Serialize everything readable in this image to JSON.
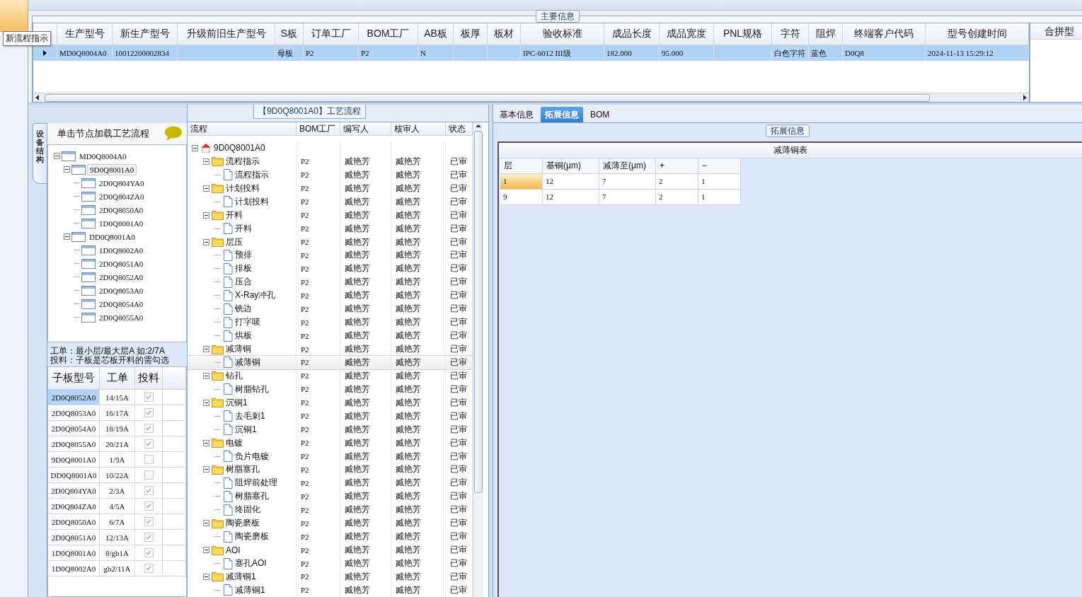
{
  "tooltip": "新流程指示",
  "main_info": {
    "title": "主要信息",
    "columns": [
      "生产型号",
      "新生产型号",
      "升级前旧生产型号",
      "S板",
      "订单工厂",
      "BOM工厂",
      "AB板",
      "板厚",
      "板材",
      "验收标准",
      "成品长度",
      "成品宽度",
      "PNL规格",
      "字符",
      "阻焊",
      "终端客户代码",
      "型号创建时间"
    ],
    "rows": [
      {
        "selected": true,
        "cells": [
          "MD0Q8004A0",
          "10012200002834",
          null,
          "母板",
          "P2",
          "P2",
          "N",
          null,
          null,
          "IPC-6012 III级",
          "182.000",
          "95.000",
          null,
          "白色字符",
          "蓝色",
          "D0Q8",
          "2024-11-13 15:29:12"
        ]
      }
    ]
  },
  "merge_panel": {
    "title": "合拼型"
  },
  "structure": {
    "tab": "设备结构",
    "hint": "单击节点加载工艺流程",
    "tree": [
      {
        "name": "MD0Q8004A0",
        "selected": false,
        "expanded": true,
        "children": [
          {
            "name": "9D0Q8001A0",
            "selected": true,
            "expanded": true,
            "children": [
              {
                "name": "2D0Q804YA0",
                "selected": false
              },
              {
                "name": "2D0Q804ZA0",
                "selected": false
              },
              {
                "name": "2D0Q8050A0",
                "selected": false
              },
              {
                "name": "1D0Q8001A0",
                "selected": false
              }
            ]
          },
          {
            "name": "DD0Q8001A0",
            "selected": false,
            "expanded": true,
            "children": [
              {
                "name": "1D0Q8002A0",
                "selected": false
              },
              {
                "name": "2D0Q8051A0",
                "selected": false
              },
              {
                "name": "2D0Q8052A0",
                "selected": false
              },
              {
                "name": "2D0Q8053A0",
                "selected": false
              },
              {
                "name": "2D0Q8054A0",
                "selected": false
              },
              {
                "name": "2D0Q8055A0",
                "selected": false
              }
            ]
          }
        ]
      }
    ],
    "notes": [
      "工单：最小层/最大层A 如:2/7A",
      "投料：子板是芯板开料的需勾选"
    ],
    "table": {
      "columns": [
        "子板型号",
        "工单",
        "投料"
      ],
      "rows": [
        {
          "board": "2D0Q8052A0",
          "order": "14/15A",
          "checked": true,
          "selected": true
        },
        {
          "board": "2D0Q8053A0",
          "order": "16/17A",
          "checked": true,
          "selected": false
        },
        {
          "board": "2D0Q8054A0",
          "order": "18/19A",
          "checked": true,
          "selected": false
        },
        {
          "board": "2D0Q8055A0",
          "order": "20/21A",
          "checked": true,
          "selected": false
        },
        {
          "board": "9D0Q8001A0",
          "order": "1/9A",
          "checked": false,
          "selected": false
        },
        {
          "board": "DD0Q8001A0",
          "order": "10/22A",
          "checked": false,
          "selected": false
        },
        {
          "board": "2D0Q804YA0",
          "order": "2/3A",
          "checked": true,
          "selected": false
        },
        {
          "board": "2D0Q804ZA0",
          "order": "4/5A",
          "checked": true,
          "selected": false
        },
        {
          "board": "2D0Q8050A0",
          "order": "6/7A",
          "checked": true,
          "selected": false
        },
        {
          "board": "2D0Q8051A0",
          "order": "12/13A",
          "checked": true,
          "selected": false
        },
        {
          "board": "1D0Q8001A0",
          "order": "8/gb1A",
          "checked": true,
          "selected": false
        },
        {
          "board": "1D0Q8002A0",
          "order": "gb2/11A",
          "checked": true,
          "selected": false
        }
      ]
    }
  },
  "process": {
    "title": "【9D0Q8001A0】工艺流程",
    "columns": [
      "流程",
      "BOM工厂",
      "编写人",
      "核审人",
      "状态"
    ],
    "tree": {
      "name": "9D0Q8001A0",
      "selected": false,
      "expanded": true,
      "children": [
        {
          "name": "流程指示",
          "bom": "P2",
          "writer": "臧艳芳",
          "reviewer": "臧艳芳",
          "status": "已审",
          "selected": false,
          "expanded": true,
          "children": [
            {
              "name": "流程指示",
              "bom": "P2",
              "writer": "臧艳芳",
              "reviewer": "臧艳芳",
              "status": "已审",
              "selected": false
            }
          ]
        },
        {
          "name": "计划投料",
          "bom": "P2",
          "writer": "臧艳芳",
          "reviewer": "臧艳芳",
          "status": "已审",
          "selected": false,
          "expanded": true,
          "children": [
            {
              "name": "计划投料",
              "bom": "P2",
              "writer": "臧艳芳",
              "reviewer": "臧艳芳",
              "status": "已审",
              "selected": false
            }
          ]
        },
        {
          "name": "开料",
          "bom": "P2",
          "writer": "臧艳芳",
          "reviewer": "臧艳芳",
          "status": "已审",
          "selected": false,
          "expanded": true,
          "children": [
            {
              "name": "开料",
              "bom": "P2",
              "writer": "臧艳芳",
              "reviewer": "臧艳芳",
              "status": "已审",
              "selected": false
            }
          ]
        },
        {
          "name": "层压",
          "bom": "P2",
          "writer": "臧艳芳",
          "reviewer": "臧艳芳",
          "status": "已审",
          "selected": false,
          "expanded": true,
          "children": [
            {
              "name": "预排",
              "bom": "P2",
              "writer": "臧艳芳",
              "reviewer": "臧艳芳",
              "status": "已审",
              "selected": false
            },
            {
              "name": "排板",
              "bom": "P2",
              "writer": "臧艳芳",
              "reviewer": "臧艳芳",
              "status": "已审",
              "selected": false
            },
            {
              "name": "压合",
              "bom": "P2",
              "writer": "臧艳芳",
              "reviewer": "臧艳芳",
              "status": "已审",
              "selected": false
            },
            {
              "name": "X-Ray冲孔",
              "bom": "P2",
              "writer": "臧艳芳",
              "reviewer": "臧艳芳",
              "status": "已审",
              "selected": false
            },
            {
              "name": "铣边",
              "bom": "P2",
              "writer": "臧艳芳",
              "reviewer": "臧艳芳",
              "status": "已审",
              "selected": false
            },
            {
              "name": "打字唛",
              "bom": "P2",
              "writer": "臧艳芳",
              "reviewer": "臧艳芳",
              "status": "已审",
              "selected": false
            },
            {
              "name": "烘板",
              "bom": "P2",
              "writer": "臧艳芳",
              "reviewer": "臧艳芳",
              "status": "已审",
              "selected": false
            }
          ]
        },
        {
          "name": "减薄铜",
          "bom": "P2",
          "writer": "臧艳芳",
          "reviewer": "臧艳芳",
          "status": "已审",
          "selected": false,
          "expanded": true,
          "children": [
            {
              "name": "减薄铜",
              "bom": "P2",
              "writer": "臧艳芳",
              "reviewer": "臧艳芳",
              "status": "已审",
              "selected": true
            }
          ]
        },
        {
          "name": "钻孔",
          "bom": "P2",
          "writer": "臧艳芳",
          "reviewer": "臧艳芳",
          "status": "已审",
          "selected": false,
          "expanded": true,
          "children": [
            {
              "name": "树脂钻孔",
              "bom": "P2",
              "writer": "臧艳芳",
              "reviewer": "臧艳芳",
              "status": "已审",
              "selected": false
            }
          ]
        },
        {
          "name": "沉铜1",
          "bom": "P2",
          "writer": "臧艳芳",
          "reviewer": "臧艳芳",
          "status": "已审",
          "selected": false,
          "expanded": true,
          "children": [
            {
              "name": "去毛刺1",
              "bom": "P2",
              "writer": "臧艳芳",
              "reviewer": "臧艳芳",
              "status": "已审",
              "selected": false
            },
            {
              "name": "沉铜1",
              "bom": "P2",
              "writer": "臧艳芳",
              "reviewer": "臧艳芳",
              "status": "已审",
              "selected": false
            }
          ]
        },
        {
          "name": "电镀",
          "bom": "P2",
          "writer": "臧艳芳",
          "reviewer": "臧艳芳",
          "status": "已审",
          "selected": false,
          "expanded": true,
          "children": [
            {
              "name": "负片电镀",
              "bom": "P2",
              "writer": "臧艳芳",
              "reviewer": "臧艳芳",
              "status": "已审",
              "selected": false
            }
          ]
        },
        {
          "name": "树脂塞孔",
          "bom": "P2",
          "writer": "臧艳芳",
          "reviewer": "臧艳芳",
          "status": "已审",
          "selected": false,
          "expanded": true,
          "children": [
            {
              "name": "阻焊前处理",
              "bom": "P2",
              "writer": "臧艳芳",
              "reviewer": "臧艳芳",
              "status": "已审",
              "selected": false
            },
            {
              "name": "树脂塞孔",
              "bom": "P2",
              "writer": "臧艳芳",
              "reviewer": "臧艳芳",
              "status": "已审",
              "selected": false
            },
            {
              "name": "终固化",
              "bom": "P2",
              "writer": "臧艳芳",
              "reviewer": "臧艳芳",
              "status": "已审",
              "selected": false
            }
          ]
        },
        {
          "name": "陶瓷磨板",
          "bom": "P2",
          "writer": "臧艳芳",
          "reviewer": "臧艳芳",
          "status": "已审",
          "selected": false,
          "expanded": true,
          "children": [
            {
              "name": "陶瓷磨板",
              "bom": "P2",
              "writer": "臧艳芳",
              "reviewer": "臧艳芳",
              "status": "已审",
              "selected": false
            }
          ]
        },
        {
          "name": "AOI",
          "bom": "P2",
          "writer": "臧艳芳",
          "reviewer": "臧艳芳",
          "status": "已审",
          "selected": false,
          "expanded": true,
          "children": [
            {
              "name": "塞孔AOI",
              "bom": "P2",
              "writer": "臧艳芳",
              "reviewer": "臧艳芳",
              "status": "已审",
              "selected": false
            }
          ]
        },
        {
          "name": "减薄铜1",
          "bom": "P2",
          "writer": "臧艳芳",
          "reviewer": "臧艳芳",
          "status": "已审",
          "selected": false,
          "expanded": true,
          "children": [
            {
              "name": "减薄铜1",
              "bom": "P2",
              "writer": "臧艳芳",
              "reviewer": "臧艳芳",
              "status": "已审",
              "selected": false
            }
          ]
        }
      ]
    }
  },
  "detail": {
    "tabs": [
      {
        "label": "基本信息",
        "selected": false
      },
      {
        "label": "拓展信息",
        "selected": true
      },
      {
        "label": "BOM",
        "selected": false
      }
    ],
    "group_title": "拓展信息",
    "table": {
      "title": "减薄铜表",
      "columns": [
        "层",
        "基铜(μm)",
        "减薄至(μm)",
        "+",
        "−"
      ],
      "rows": [
        {
          "cells": [
            "1",
            "12",
            "7",
            "2",
            "1"
          ],
          "selected": true
        },
        {
          "cells": [
            "9",
            "12",
            "7",
            "2",
            "1"
          ],
          "selected": false
        }
      ]
    }
  }
}
